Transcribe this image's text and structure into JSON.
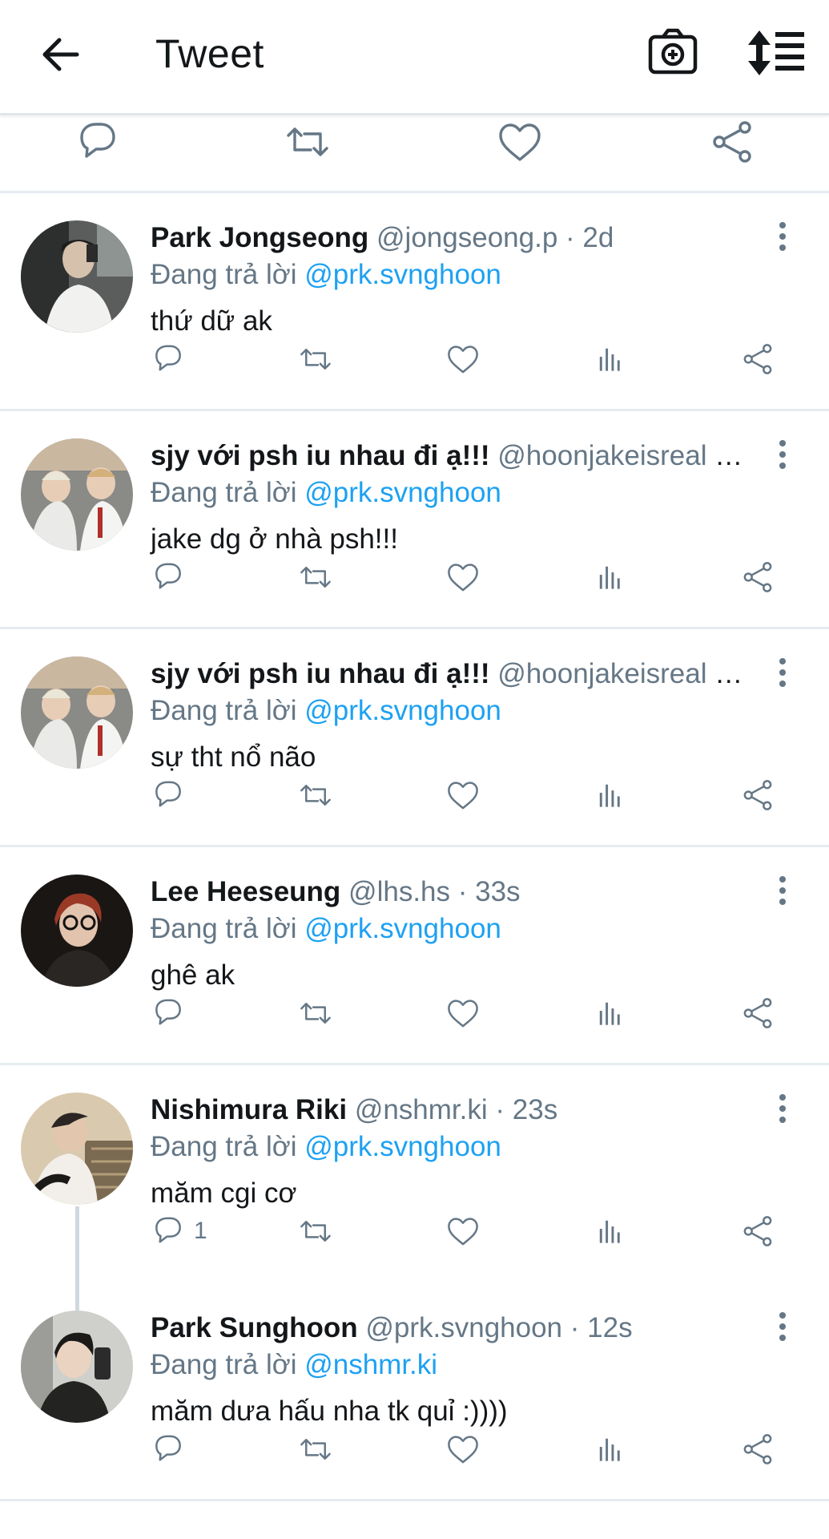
{
  "header": {
    "title": "Tweet",
    "back_icon": "arrow-left-icon",
    "camera_icon": "camera-plus-icon",
    "sort_icon": "sort-arrows-list-icon"
  },
  "colors": {
    "accent": "#1da1f2",
    "muted": "#657786",
    "text": "#14171a",
    "divider": "#e6ecf0"
  },
  "replies": [
    {
      "name": "Park Jongseong",
      "handle": "@jongseong.p",
      "sep": " · ",
      "time": "2d",
      "replying_prefix": "Đang trả lời ",
      "mention": "@prk.svnghoon",
      "text": "thứ dữ ak",
      "reply_count": ""
    },
    {
      "name": "sjy với psh iu nhau đi ạ!!!",
      "handle": "@hoonjakeisreal",
      "sep": " · ",
      "time": "...",
      "replying_prefix": "Đang trả lời ",
      "mention": "@prk.svnghoon",
      "text": "jake dg ở nhà psh!!!",
      "reply_count": ""
    },
    {
      "name": "sjy với psh iu nhau đi ạ!!!",
      "handle": "@hoonjakeisreal",
      "sep": " · ",
      "time": "...",
      "replying_prefix": "Đang trả lời ",
      "mention": "@prk.svnghoon",
      "text": "sự tht nổ não",
      "reply_count": ""
    },
    {
      "name": "Lee Heeseung",
      "handle": "@lhs.hs",
      "sep": " · ",
      "time": "33s",
      "replying_prefix": "Đang trả lời ",
      "mention": "@prk.svnghoon",
      "text": "ghê ak",
      "reply_count": ""
    },
    {
      "name": "Nishimura Riki",
      "handle": "@nshmr.ki",
      "sep": " · ",
      "time": "23s",
      "replying_prefix": "Đang trả lời ",
      "mention": "@prk.svnghoon",
      "text": "măm cgi cơ",
      "reply_count": "1"
    },
    {
      "name": "Park Sunghoon",
      "handle": "@prk.svnghoon",
      "sep": " · ",
      "time": "12s",
      "replying_prefix": "Đang trả lời ",
      "mention": "@nshmr.ki",
      "text": "măm dưa hấu nha tk quỉ :))))",
      "reply_count": ""
    }
  ]
}
